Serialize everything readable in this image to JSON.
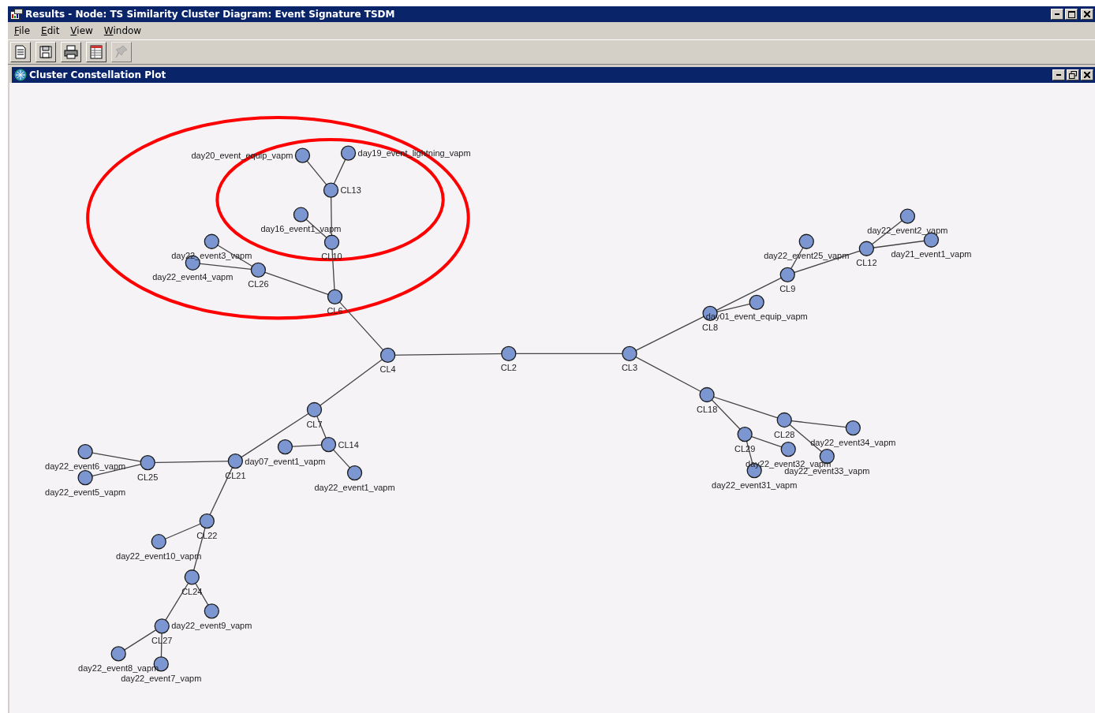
{
  "window": {
    "title": "Results - Node: TS Similarity Cluster  Diagram: Event Signature TSDM"
  },
  "menu": [
    {
      "label": "File"
    },
    {
      "label": "Edit"
    },
    {
      "label": "View"
    },
    {
      "label": "Window"
    }
  ],
  "toolbar": [
    {
      "kind": "new",
      "disabled": false
    },
    {
      "kind": "save",
      "disabled": false
    },
    {
      "kind": "print",
      "disabled": false
    },
    {
      "kind": "table",
      "disabled": false
    },
    {
      "kind": "pin",
      "disabled": true
    }
  ],
  "plot_window": {
    "title": "Cluster Constellation Plot"
  },
  "plot": {
    "root": {
      "label": "CL2",
      "children": [
        {
          "label": "CL4",
          "children": [
            {
              "label": "CL6",
              "children": [
                {
                  "label": "CL26",
                  "children": [
                    {
                      "label": "day22_event3_vapm"
                    },
                    {
                      "label": "day22_event4_vapm"
                    }
                  ]
                },
                {
                  "label": "CL10",
                  "children": [
                    {
                      "label": "day16_event1_vapm"
                    },
                    {
                      "label": "CL13",
                      "children": [
                        {
                          "label": "day20_event_equip_vapm"
                        },
                        {
                          "label": "day19_event_lightning_vapm"
                        }
                      ]
                    }
                  ]
                }
              ]
            },
            {
              "label": "CL7",
              "children": [
                {
                  "label": "CL14",
                  "children": [
                    {
                      "label": "day07_event1_vapm"
                    },
                    {
                      "label": "day22_event1_vapm"
                    }
                  ]
                },
                {
                  "label": "CL21",
                  "children": [
                    {
                      "label": "CL25",
                      "children": [
                        {
                          "label": "day22_event6_vapm"
                        },
                        {
                          "label": "day22_event5_vapm"
                        }
                      ]
                    },
                    {
                      "label": "CL22",
                      "children": [
                        {
                          "label": "day22_event10_vapm"
                        },
                        {
                          "label": "CL24",
                          "children": [
                            {
                              "label": "day22_event9_vapm"
                            },
                            {
                              "label": "CL27",
                              "children": [
                                {
                                  "label": "day22_event8_vapm"
                                },
                                {
                                  "label": "day22_event7_vapm"
                                }
                              ]
                            }
                          ]
                        }
                      ]
                    }
                  ]
                }
              ]
            }
          ]
        },
        {
          "label": "CL3",
          "children": [
            {
              "label": "CL8",
              "children": [
                {
                  "label": "day01_event_equip_vapm"
                },
                {
                  "label": "CL9",
                  "children": [
                    {
                      "label": "day22_event25_vapm"
                    },
                    {
                      "label": "CL12",
                      "children": [
                        {
                          "label": "day22_event2_vapm"
                        },
                        {
                          "label": "day21_event1_vapm"
                        }
                      ]
                    }
                  ]
                }
              ]
            },
            {
              "label": "CL18",
              "children": [
                {
                  "label": "CL28",
                  "children": [
                    {
                      "label": "day22_event34_vapm"
                    },
                    {
                      "label": "day22_event33_vapm"
                    }
                  ]
                },
                {
                  "label": "CL29",
                  "children": [
                    {
                      "label": "day22_event32_vapm"
                    },
                    {
                      "label": "day22_event31_vapm"
                    }
                  ]
                }
              ]
            }
          ]
        }
      ]
    }
  }
}
